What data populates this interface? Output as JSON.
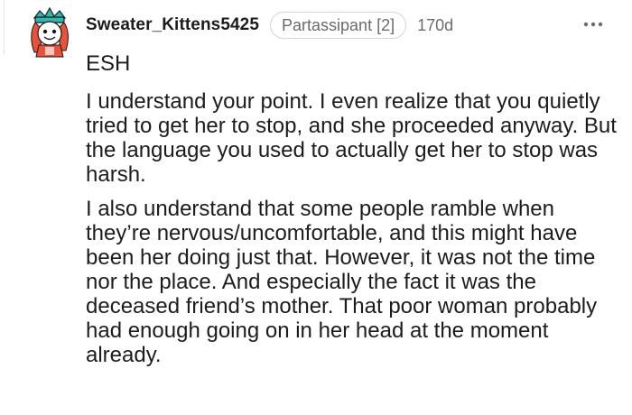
{
  "comment": {
    "username": "Sweater_Kittens5425",
    "flair": "Partassipant [2]",
    "age": "170d",
    "more_icon": "more-horizontal-dots",
    "verdict": "ESH",
    "paragraphs": [
      "I understand your point. I even realize that you quietly tried to get her to stop, and she proceeded anyway. But the language you used to actually get her to stop was harsh.",
      "I also understand that some people ramble when they’re nervous/uncomfortable, and this might have been her doing just that. However, it was not the time nor the place. And especially the fact it was the deceased friend’s mother. That poor woman probably had enough going on in her head at the moment already."
    ]
  },
  "colors": {
    "text": "#1c1c1c",
    "meta": "#6b6b6b",
    "badge_border": "#d4d4d4",
    "avatar_hair": "#e8513a",
    "avatar_hat": "#2fb8b0"
  }
}
